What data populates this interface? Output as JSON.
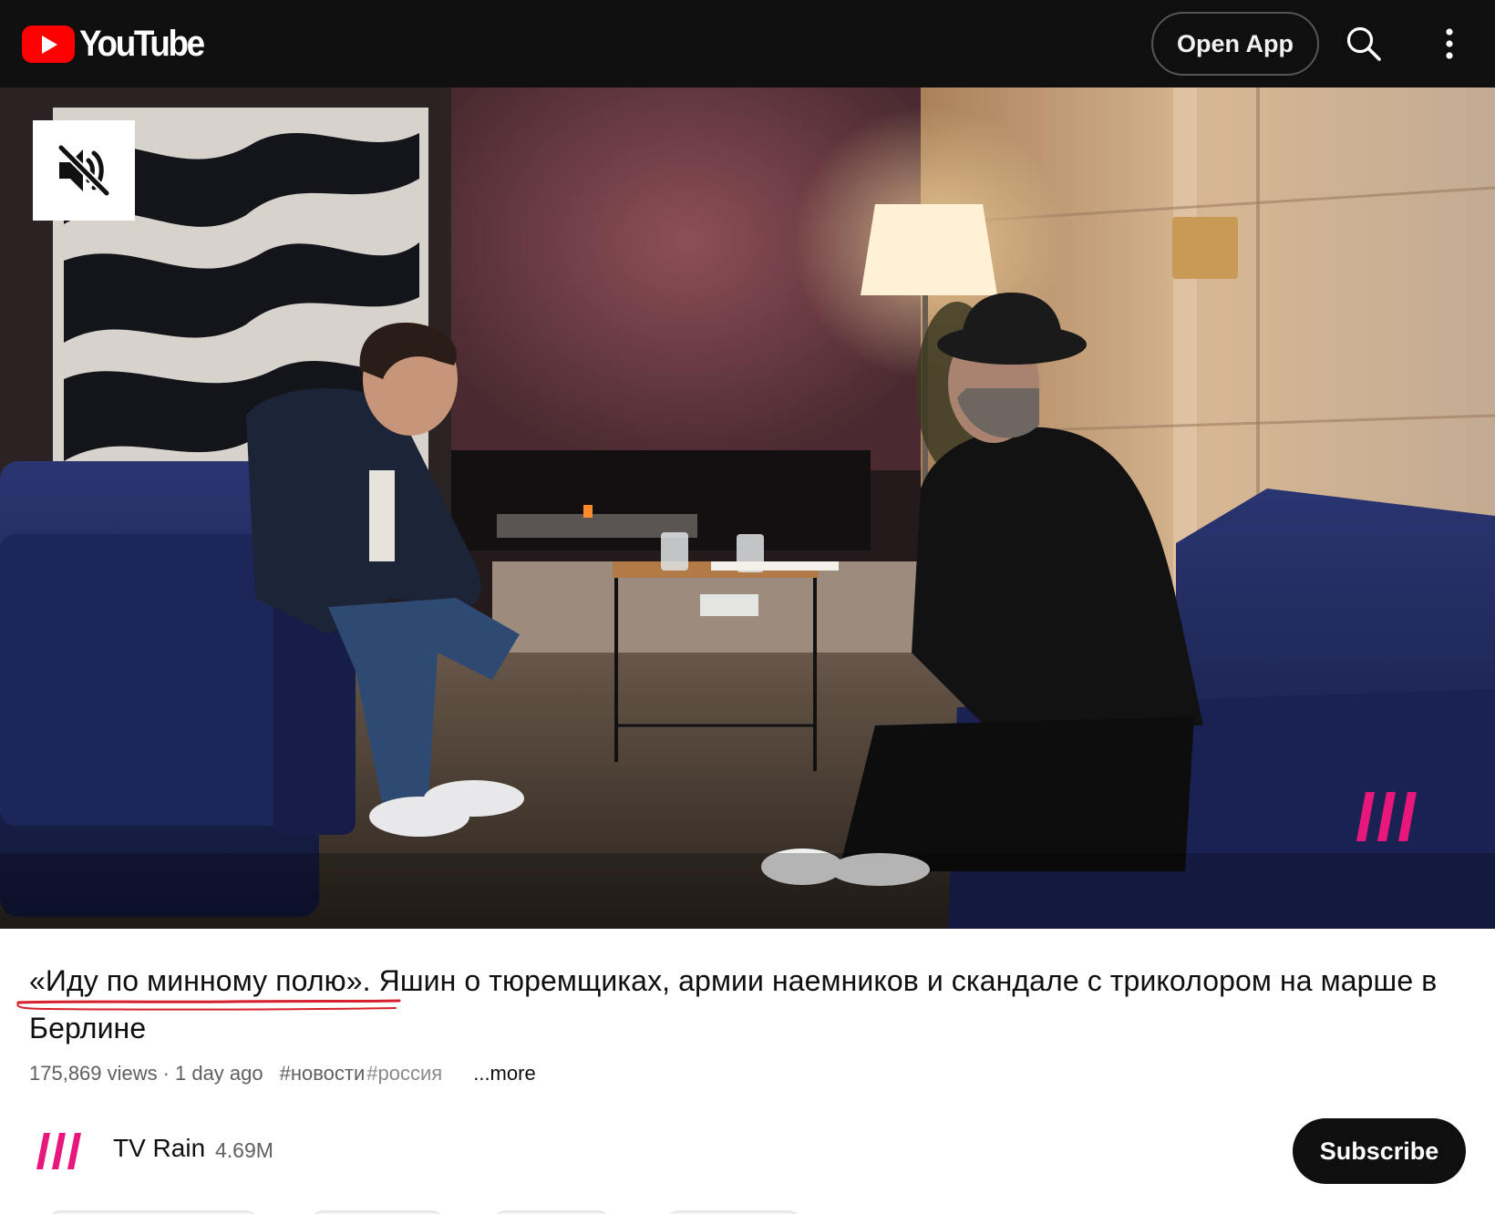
{
  "header": {
    "brand": "YouTube",
    "open_app_label": "Open App",
    "icons": [
      "youtube-logo-icon",
      "search-icon",
      "more-vert-icon"
    ]
  },
  "player": {
    "muted": true,
    "icons": [
      "volume-off-icon",
      "tv-rain-watermark-icon"
    ]
  },
  "video": {
    "title": "«Иду по минному полю». Яшин о тюремщиках, армии наемников и скандале с триколором на марше в Берлине",
    "views": "175,869 views",
    "separator": "·",
    "age": "1 day ago",
    "tags": [
      "#новости",
      "#россия"
    ],
    "more_label": "...more"
  },
  "channel": {
    "name": "TV Rain",
    "subscribers": "4.69M",
    "subscribe_label": "Subscribe"
  },
  "colors": {
    "topbar_bg": "#0f0f0f",
    "brand_red": "#ff0000",
    "tv_rain_pink": "#e8177b",
    "annotation_red": "#d6202c",
    "text_primary": "#0f0f0f",
    "text_secondary": "#606060"
  }
}
